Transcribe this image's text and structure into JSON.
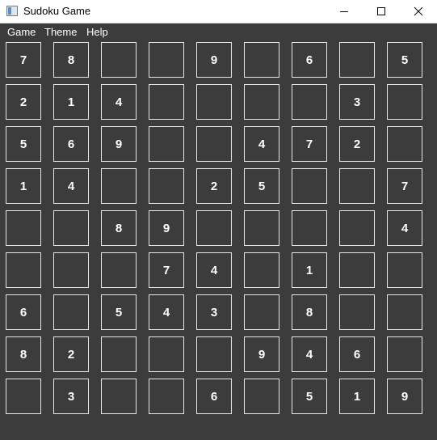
{
  "window": {
    "title": "Sudoku Game",
    "controls": [
      "minimize",
      "maximize",
      "close"
    ]
  },
  "menu": {
    "items": [
      "Game",
      "Theme",
      "Help"
    ]
  },
  "board": {
    "rows": [
      [
        "7",
        "8",
        "",
        "",
        "9",
        "",
        "6",
        "",
        "5"
      ],
      [
        "2",
        "1",
        "4",
        "",
        "",
        "",
        "",
        "3",
        ""
      ],
      [
        "5",
        "6",
        "9",
        "",
        "",
        "4",
        "7",
        "2",
        ""
      ],
      [
        "1",
        "4",
        "",
        "",
        "2",
        "5",
        "",
        "",
        "7"
      ],
      [
        "",
        "",
        "8",
        "9",
        "",
        "",
        "",
        "",
        "4"
      ],
      [
        "",
        "",
        "",
        "7",
        "4",
        "",
        "1",
        "",
        ""
      ],
      [
        "6",
        "",
        "5",
        "4",
        "3",
        "",
        "8",
        "",
        ""
      ],
      [
        "8",
        "2",
        "",
        "",
        "",
        "9",
        "4",
        "6",
        ""
      ],
      [
        "",
        "3",
        "",
        "",
        "6",
        "",
        "5",
        "1",
        "9"
      ]
    ]
  },
  "colors": {
    "background": "#3c3c3c",
    "cell_border": "#e8e8e8",
    "digit": "#ffffff",
    "titlebar": "#ffffff"
  }
}
